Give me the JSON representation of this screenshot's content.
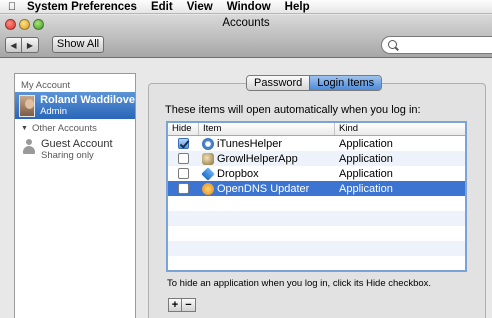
{
  "menubar": {
    "apple": "",
    "items": [
      "System Preferences",
      "Edit",
      "View",
      "Window",
      "Help"
    ]
  },
  "window": {
    "title": "Accounts",
    "show_all": "Show All",
    "search_placeholder": ""
  },
  "sidebar": {
    "my_account_header": "My Account",
    "current_user": {
      "name": "Roland Waddilove",
      "role": "Admin"
    },
    "other_header": "Other Accounts",
    "guest": {
      "name": "Guest Account",
      "sub": "Sharing only"
    }
  },
  "tabs": {
    "password": "Password",
    "login_items": "Login Items",
    "selected": "Login Items"
  },
  "login_items": {
    "intro": "These items will open automatically when you log in:",
    "columns": {
      "hide": "Hide",
      "item": "Item",
      "kind": "Kind"
    },
    "rows": [
      {
        "name": "iTunesHelper",
        "kind": "Application",
        "hide": true,
        "icon": "itunes-icon",
        "selected": false
      },
      {
        "name": "GrowlHelperApp",
        "kind": "Application",
        "hide": false,
        "icon": "growl-icon",
        "selected": false
      },
      {
        "name": "Dropbox",
        "kind": "Application",
        "hide": false,
        "icon": "dropbox-icon",
        "selected": false
      },
      {
        "name": "OpenDNS Updater",
        "kind": "Application",
        "hide": false,
        "icon": "opendns-icon",
        "selected": true
      }
    ],
    "hint": "To hide an application when you log in, click its Hide checkbox.",
    "add_label": "+",
    "remove_label": "−"
  },
  "colors": {
    "selection": "#3b74d1",
    "accent": "#7aa4d9"
  }
}
